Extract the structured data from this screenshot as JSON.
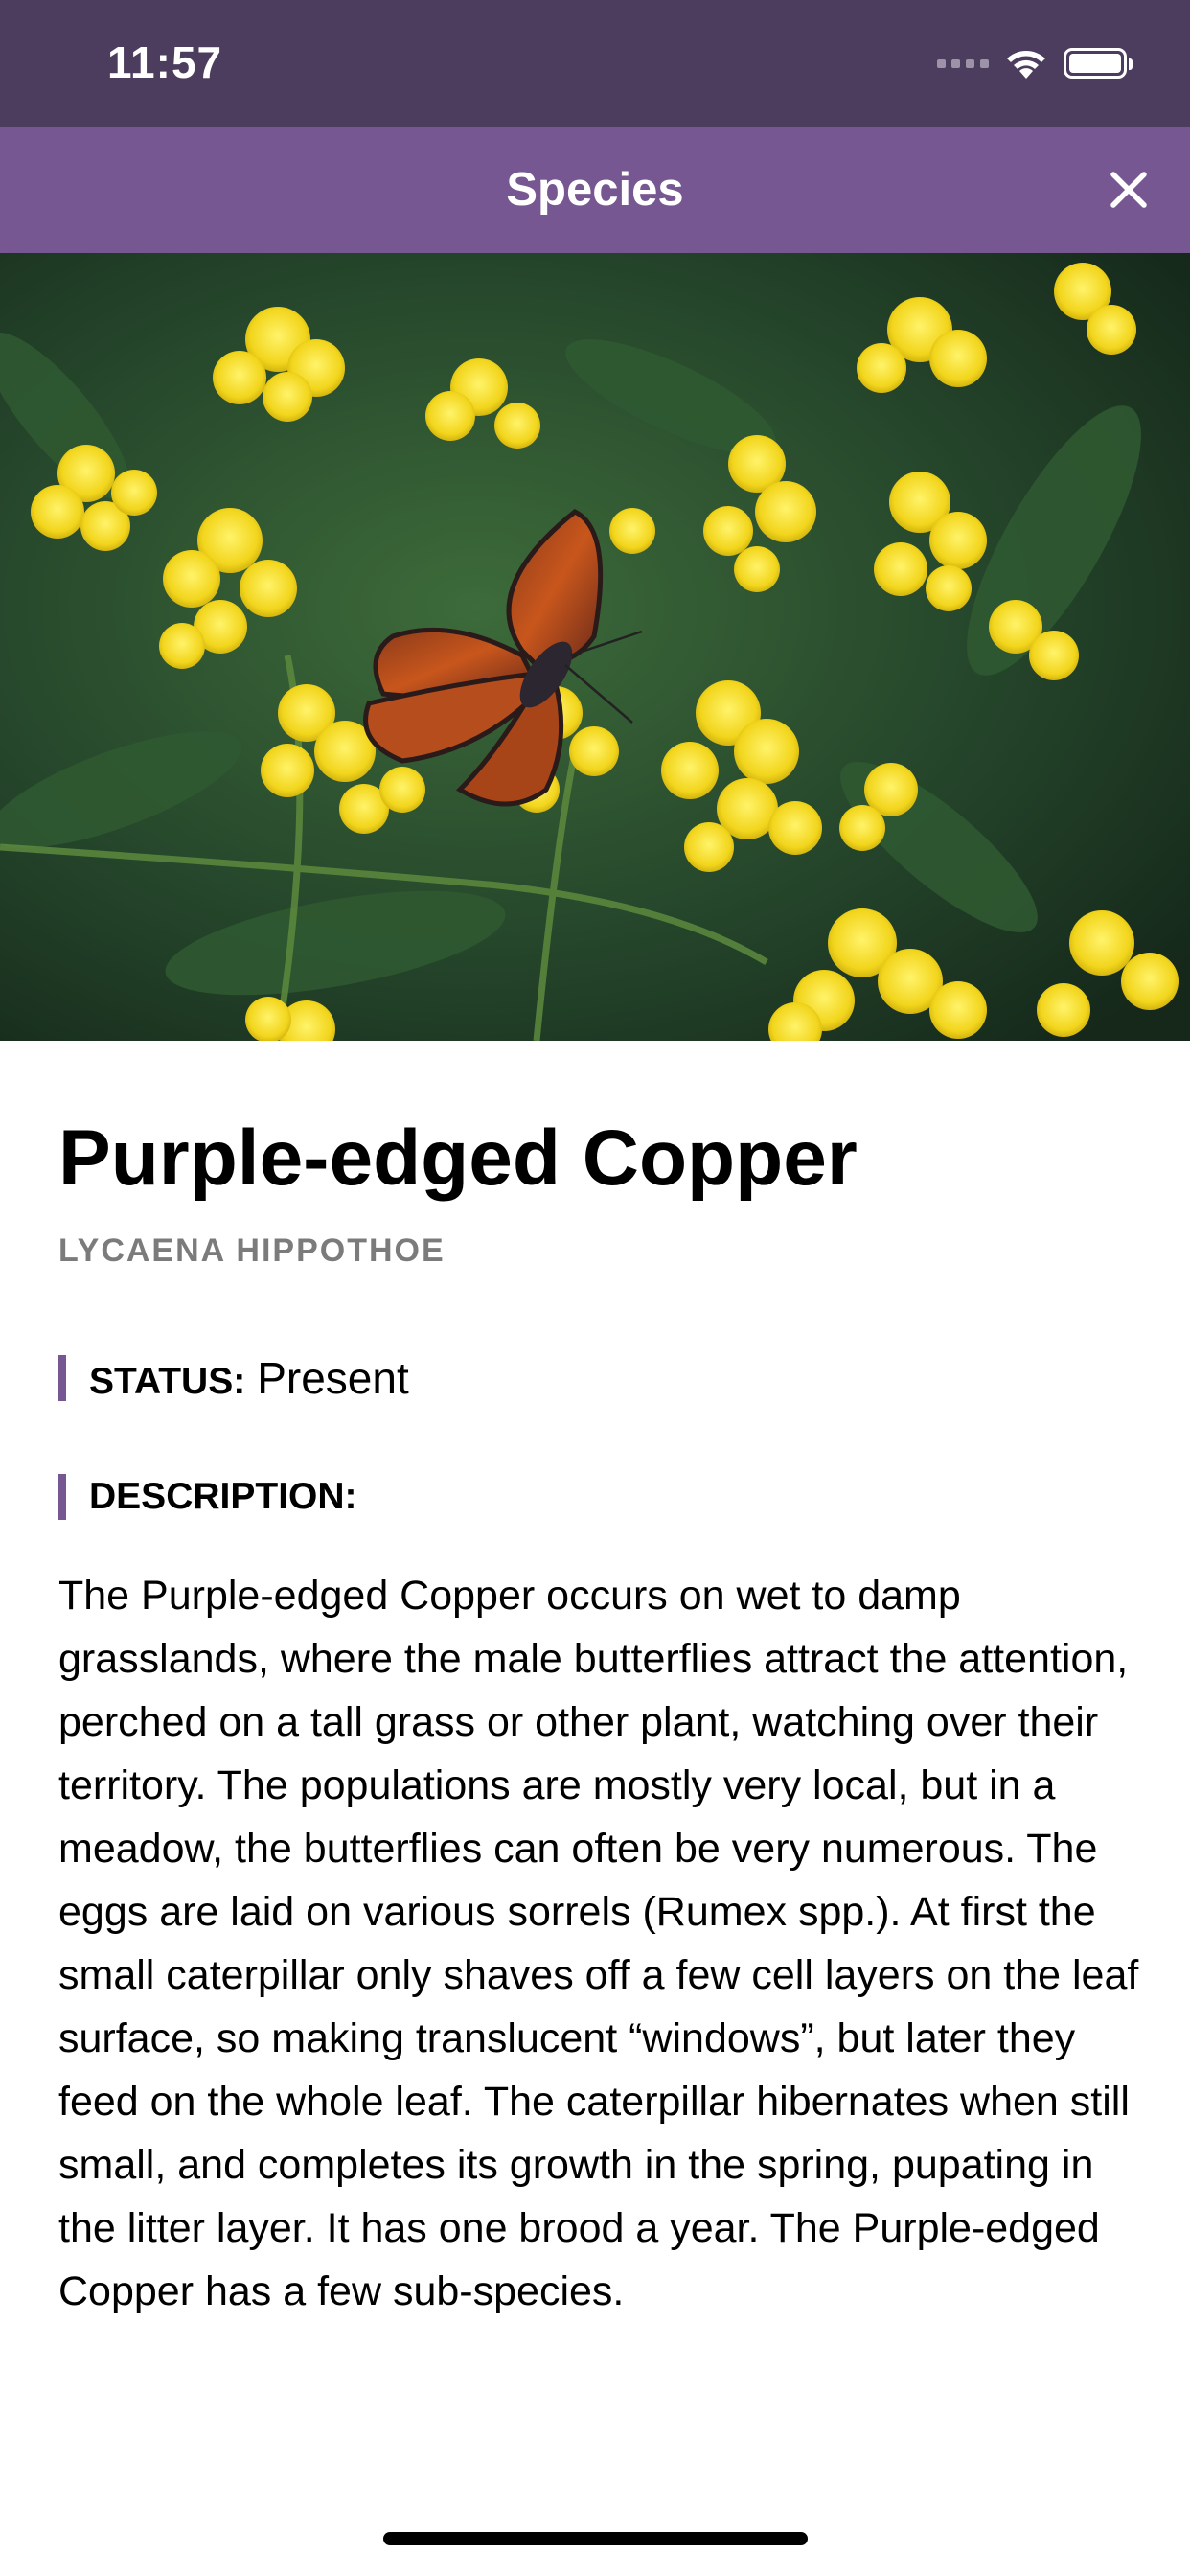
{
  "status_bar": {
    "time": "11:57"
  },
  "nav": {
    "title": "Species"
  },
  "species": {
    "common_name": "Purple-edged Copper",
    "scientific_name": "LYCAENA HIPPOTHOE",
    "status_label": "STATUS:",
    "status_value": "Present",
    "description_label": "DESCRIPTION:",
    "description": "The Purple-edged Copper occurs on wet to damp grasslands, where the male butterflies attract the attention, perched on a tall grass or other plant, watching over their territory. The populations are mostly very local, but in a meadow, the butterflies can often be very numerous. The eggs are laid on various sorrels (Rumex spp.). At first the small caterpillar only shaves off a few cell layers on the leaf surface, so making translucent “windows”, but later they feed on the whole leaf. The caterpillar hibernates when still small, and completes its growth in the spring, pupating in the litter layer. It has one brood a year. The Purple-edged Copper has a few sub-species."
  },
  "colors": {
    "status_bar": "#4c3c5e",
    "nav_bar": "#765791",
    "accent": "#765791"
  },
  "icons": {
    "close": "close-icon",
    "wifi": "wifi-icon",
    "battery": "battery-icon",
    "signal": "signal-icon"
  }
}
